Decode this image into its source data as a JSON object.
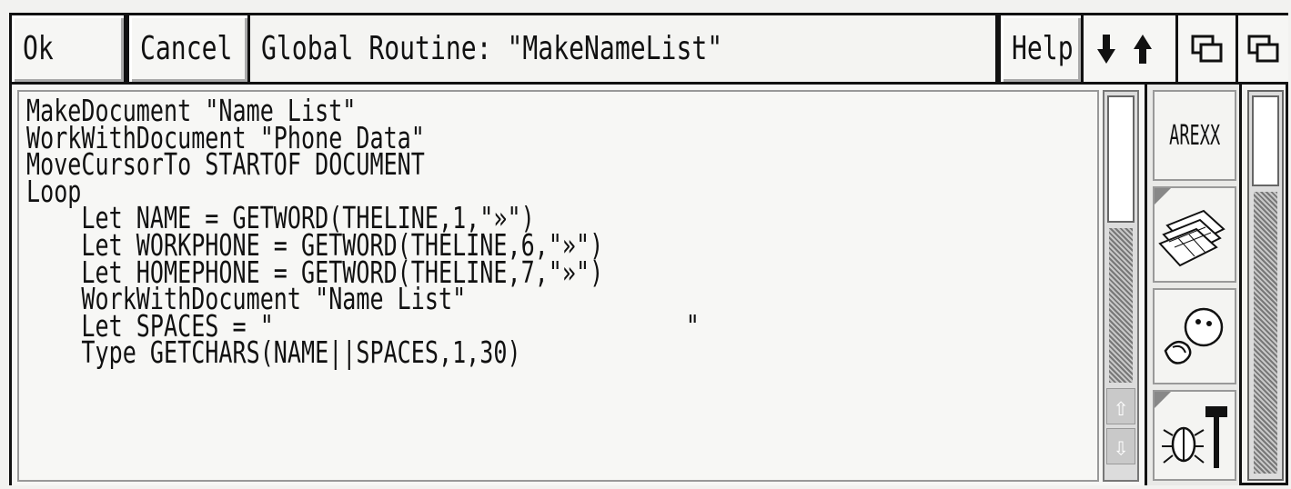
{
  "toolbar": {
    "ok_label": "Ok",
    "cancel_label": "Cancel",
    "title": "Global Routine: \"MakeNameList\"",
    "help_label": "Help"
  },
  "editor": {
    "lines": [
      "MakeDocument \"Name List\"",
      "WorkWithDocument \"Phone Data\"",
      "MoveCursorTo STARTOF DOCUMENT",
      "Loop",
      "    Let NAME = GETWORD(THELINE,1,\"»\")",
      "    Let WORKPHONE = GETWORD(THELINE,6,\"»\")",
      "    Let HOMEPHONE = GETWORD(THELINE,7,\"»\")",
      "    WorkWithDocument \"Name List\"",
      "    Let SPACES = \"                              \"",
      "    Type GETCHARS(NAME||SPACES,1,30)"
    ]
  },
  "tools": {
    "arexx_label": "AREXX"
  },
  "icons": {
    "arrows": "up-down-arrows-icon",
    "window_depth": "window-depth-icon",
    "spreadsheet": "spreadsheet-icon",
    "clipart": "clipart-icon",
    "debug": "bug-hammer-icon"
  }
}
